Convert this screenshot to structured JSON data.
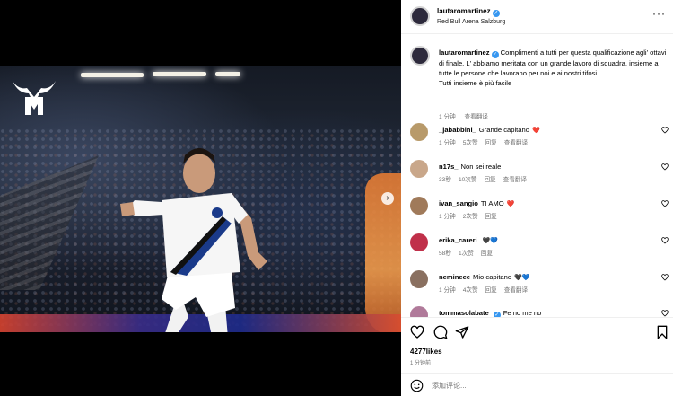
{
  "post": {
    "username": "lautaromartinez",
    "location": "Red Bull Arena Salzburg",
    "caption_lines": [
      "Complimenti a tutti per questa qualificazione agli' ottavi di finale. L' abbiamo meritata con un grande lavoro di squadra, insieme a tutte le persone che lavorano per noi e ai nostri tifosi.",
      "Tutti insieme è più facile"
    ],
    "caption_time": "1 分钟",
    "see_translation": "查看翻译",
    "likes": "4277likes",
    "posted_ago": "1 分钟前"
  },
  "comments": [
    {
      "username": "_jababbini_",
      "text": "Grande capitano",
      "emoji": "❤️",
      "emoji_color": "#ed1c24",
      "time": "1 分钟",
      "likes": "5次赞",
      "reply": "回复",
      "translate": "查看翻译",
      "avatar_color": "#b89a6a"
    },
    {
      "username": "n17s_",
      "text": "Non sei reale",
      "emoji": "",
      "time": "33秒",
      "likes": "10次赞",
      "reply": "回复",
      "translate": "查看翻译",
      "avatar_color": "#c9a78a"
    },
    {
      "username": "ivan_sangio",
      "text": "TI AMO",
      "emoji": "❤️",
      "emoji_color": "#ed1c24",
      "time": "1 分钟",
      "likes": "2次赞",
      "reply": "回复",
      "translate": "",
      "avatar_color": "#a07a5a"
    },
    {
      "username": "erika_careri",
      "text": "",
      "emoji": "🖤💙",
      "time": "58秒",
      "likes": "1次赞",
      "reply": "回复",
      "translate": "",
      "avatar_color": "#c0304a"
    },
    {
      "username": "nemineee",
      "text": "Mio capitano",
      "emoji": "🖤💙",
      "time": "1 分钟",
      "likes": "4次赞",
      "reply": "回复",
      "translate": "查看翻译",
      "avatar_color": "#8a7060"
    },
    {
      "username": "tommasolabate",
      "text": "Fe no me no",
      "emoji": "",
      "time": "",
      "likes": "",
      "reply": "",
      "translate": "",
      "avatar_color": "#b07a9a"
    }
  ],
  "composer": {
    "placeholder": "添加评论..."
  },
  "colors": {
    "verified": "#3797f0",
    "meta": "#737373",
    "heart_red": "#ed1c24",
    "blue_heart": "#1f7ae0"
  }
}
